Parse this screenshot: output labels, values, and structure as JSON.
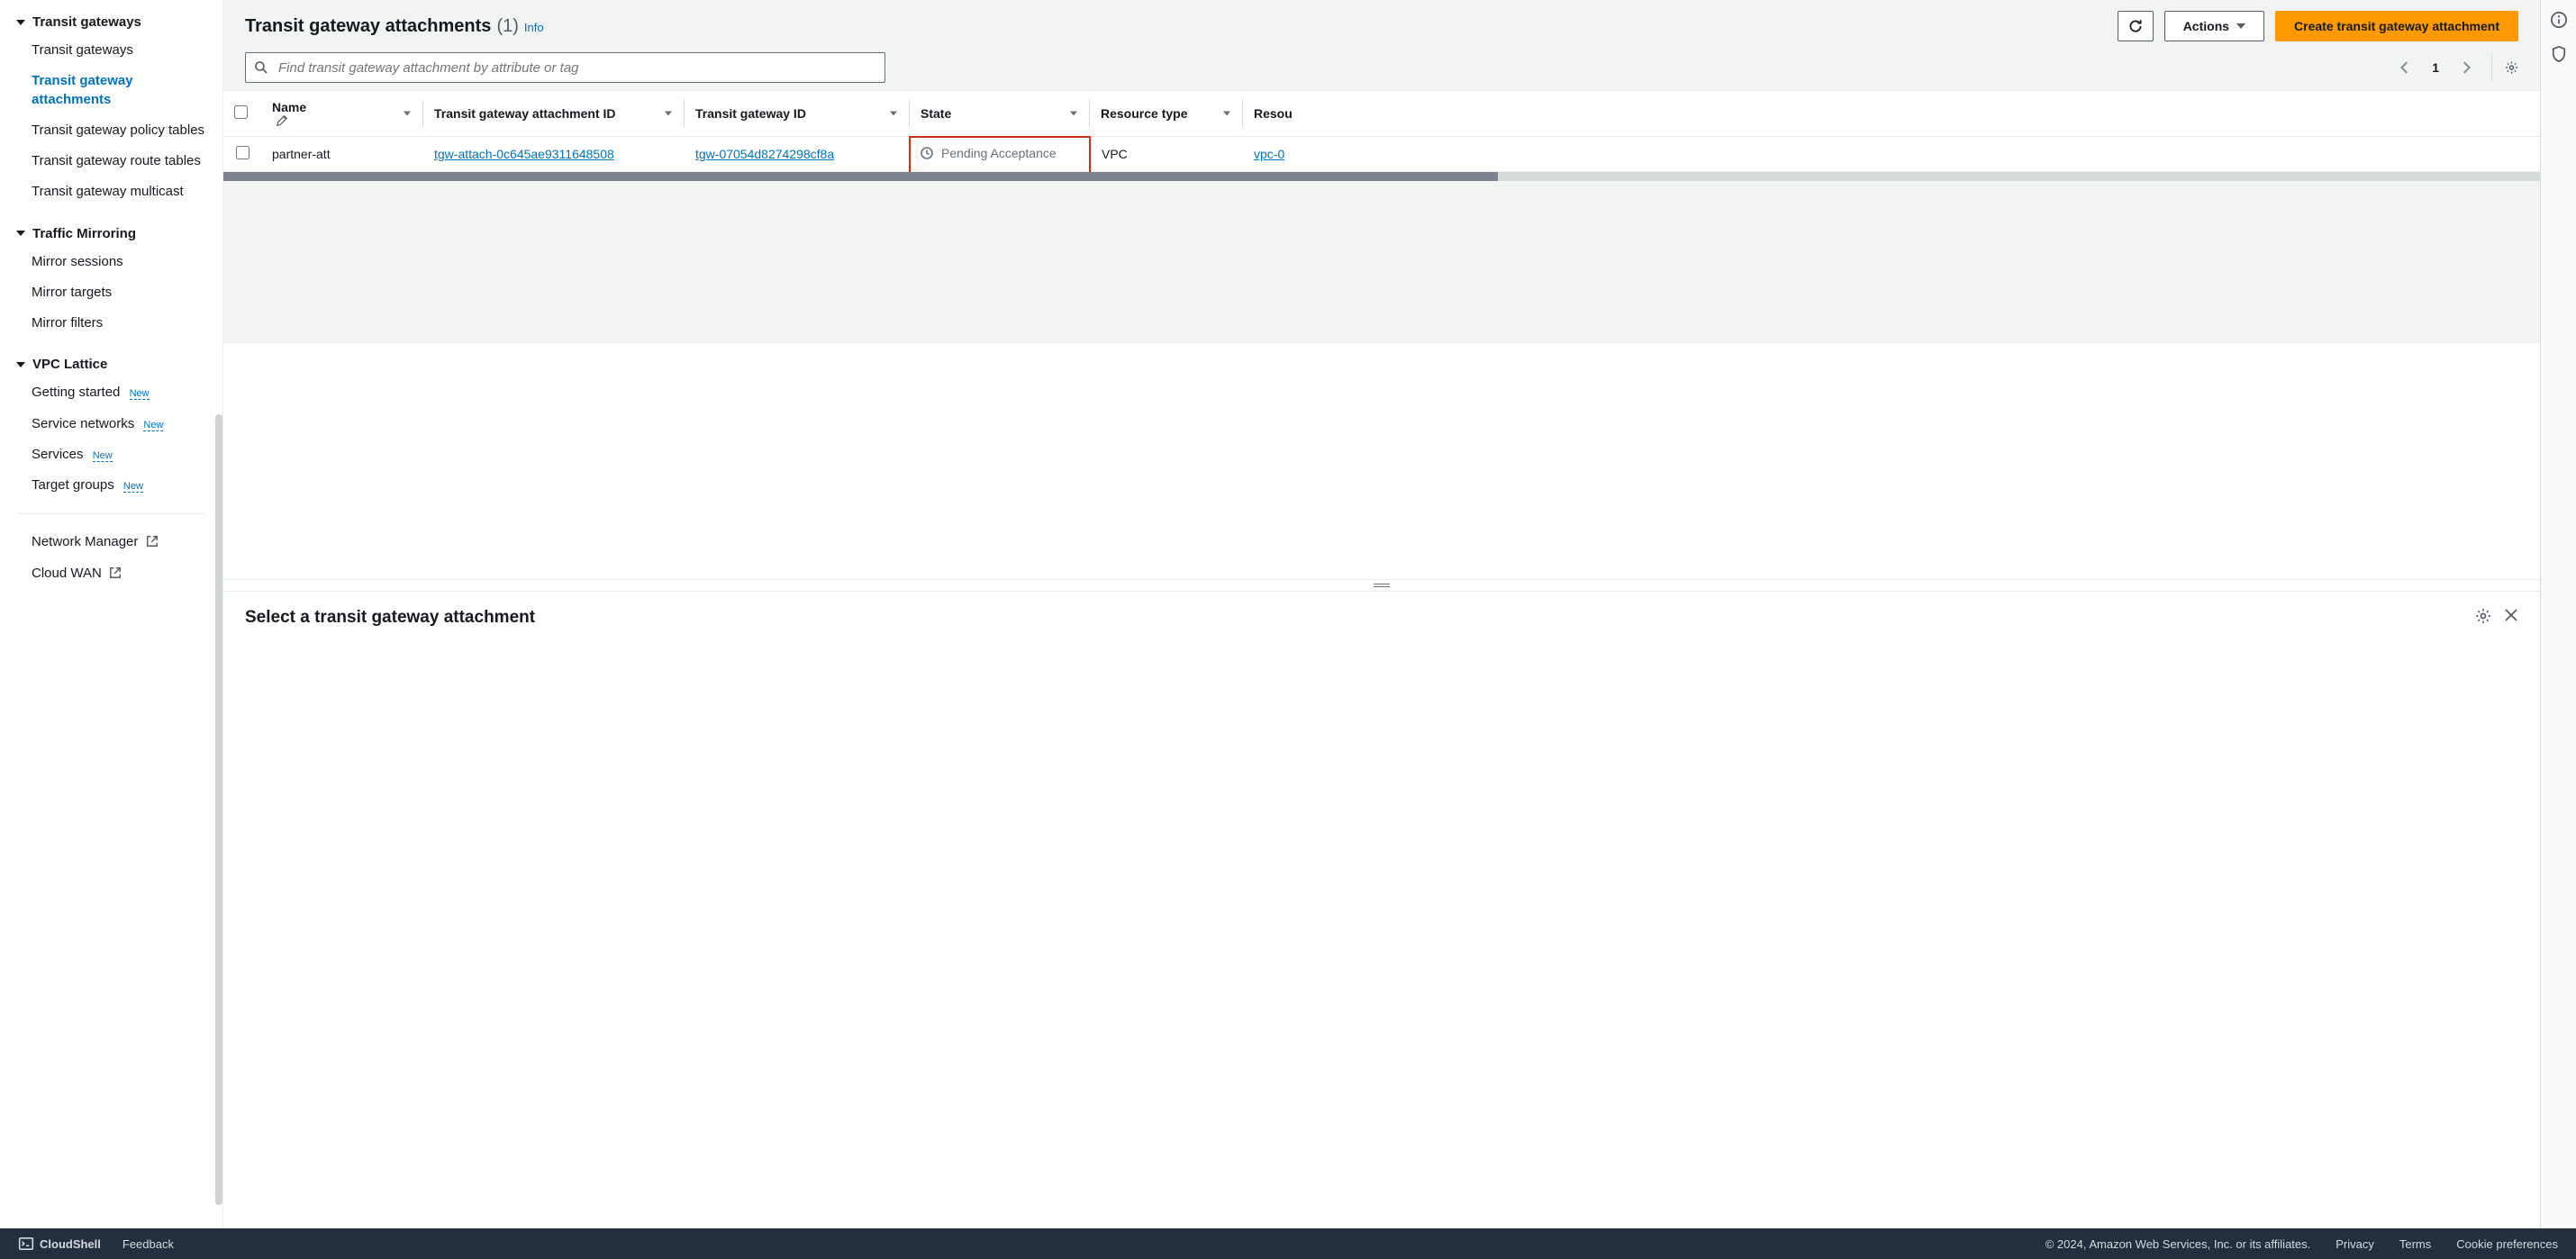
{
  "sidebar": {
    "sections": [
      {
        "title": "Transit gateways",
        "items": [
          {
            "label": "Transit gateways"
          },
          {
            "label": "Transit gateway attachments",
            "active": true
          },
          {
            "label": "Transit gateway policy tables"
          },
          {
            "label": "Transit gateway route tables"
          },
          {
            "label": "Transit gateway multicast"
          }
        ]
      },
      {
        "title": "Traffic Mirroring",
        "items": [
          {
            "label": "Mirror sessions"
          },
          {
            "label": "Mirror targets"
          },
          {
            "label": "Mirror filters"
          }
        ]
      },
      {
        "title": "VPC Lattice",
        "items": [
          {
            "label": "Getting started",
            "badge": "New"
          },
          {
            "label": "Service networks",
            "badge": "New"
          },
          {
            "label": "Services",
            "badge": "New"
          },
          {
            "label": "Target groups",
            "badge": "New"
          }
        ]
      }
    ],
    "external_links": [
      {
        "label": "Network Manager"
      },
      {
        "label": "Cloud WAN"
      }
    ]
  },
  "header": {
    "title": "Transit gateway attachments",
    "count": "(1)",
    "info": "Info",
    "actions_label": "Actions",
    "create_label": "Create transit gateway attachment"
  },
  "search": {
    "placeholder": "Find transit gateway attachment by attribute or tag"
  },
  "pagination": {
    "current": "1"
  },
  "table": {
    "columns": [
      "Name",
      "Transit gateway attachment ID",
      "Transit gateway ID",
      "State",
      "Resource type",
      "Resou"
    ],
    "rows": [
      {
        "name": "partner-att",
        "attachment_id": "tgw-attach-0c645ae9311648508",
        "tgw_id": "tgw-07054d8274298cf8a",
        "state": "Pending Acceptance",
        "resource_type": "VPC",
        "resource_id": "vpc-0"
      }
    ]
  },
  "detail": {
    "empty_title": "Select a transit gateway attachment"
  },
  "footer": {
    "cloudshell": "CloudShell",
    "feedback": "Feedback",
    "copyright": "© 2024, Amazon Web Services, Inc. or its affiliates.",
    "privacy": "Privacy",
    "terms": "Terms",
    "cookies": "Cookie preferences"
  }
}
